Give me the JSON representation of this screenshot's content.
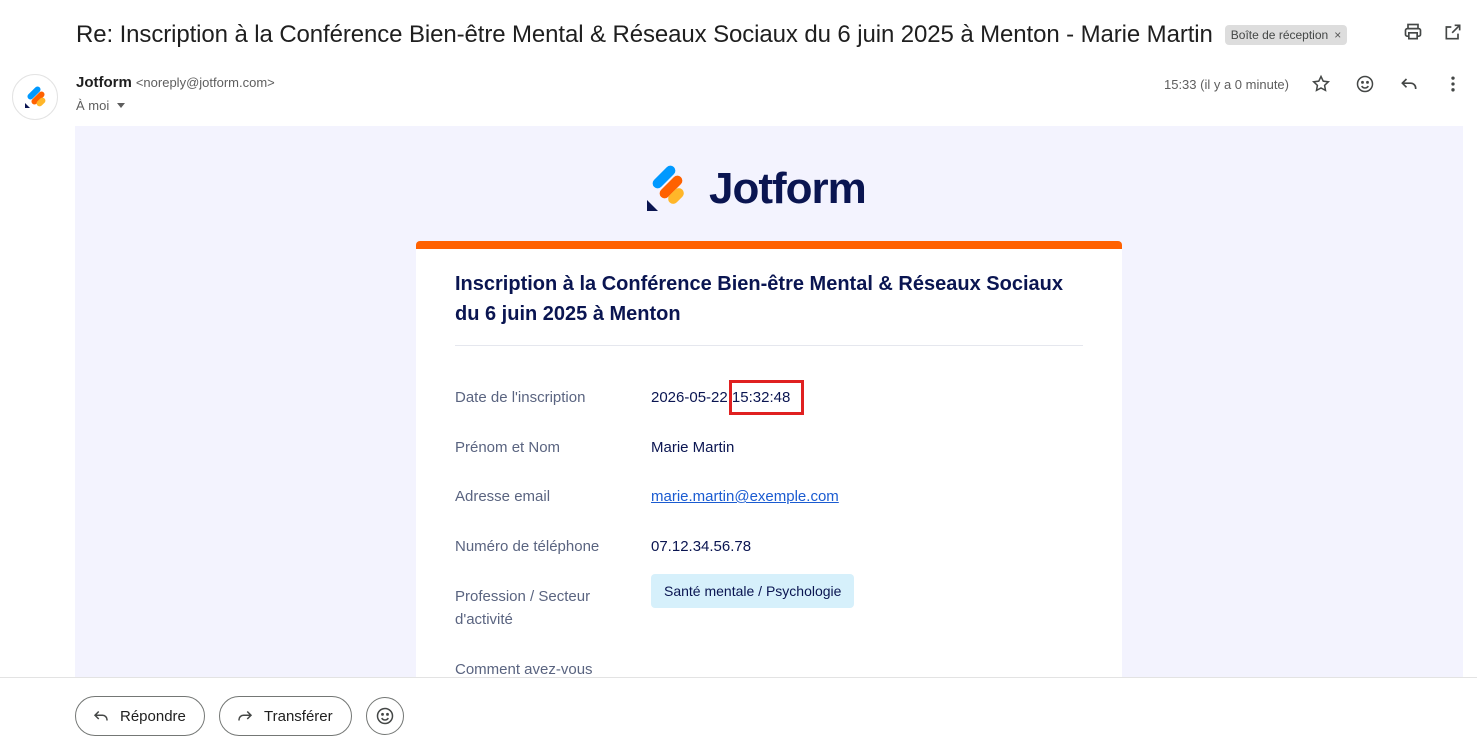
{
  "subject": {
    "text": "Re: Inscription à la Conférence Bien-être Mental & Réseaux Sociaux du 6 juin 2025 à Menton - Marie Martin",
    "label": "Boîte de réception",
    "label_close": "×"
  },
  "sender": {
    "name": "Jotform",
    "email": "<noreply@jotform.com>",
    "to": "À moi",
    "time": "15:33 (il y a 0 minute)"
  },
  "body": {
    "logo_text": "Jotform",
    "form_title": "Inscription à la Conférence Bien-être Mental & Réseaux Sociaux du 6 juin 2025 à Menton",
    "fields": [
      {
        "label": "Date de l'inscription",
        "value_date": "2026-05-22",
        "value_time": "15:32:48"
      },
      {
        "label": "Prénom et Nom",
        "value": "Marie Martin"
      },
      {
        "label": "Adresse email",
        "value": "marie.martin@exemple.com"
      },
      {
        "label": "Numéro de téléphone",
        "value": "07.12.34.56.78"
      },
      {
        "label": "Profession / Secteur d'activité",
        "value": "Santé mentale / Psychologie"
      },
      {
        "label": "Comment avez-vous",
        "value": ""
      }
    ]
  },
  "actions": {
    "reply": "Répondre",
    "forward": "Transférer"
  },
  "colors": {
    "brand_orange": "#ff6100",
    "brand_navy": "#0a1551",
    "body_bg": "#f3f3fe",
    "highlight": "#e02020",
    "tag_bg": "#d6f0fb"
  }
}
